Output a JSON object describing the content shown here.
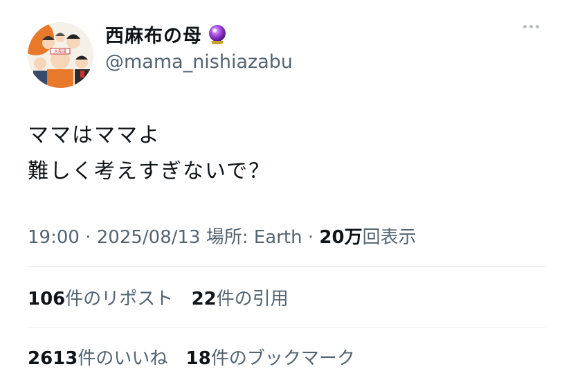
{
  "user": {
    "display_name": "西麻布の母",
    "badge_icon": "crystal-ball-icon",
    "handle": "@mama_nishiazabu",
    "avatar_sign_text": "大和魂"
  },
  "tweet": {
    "lines": [
      "ママはママよ",
      "難しく考えすぎないで？"
    ]
  },
  "meta": {
    "time": "19:00",
    "date": "2025/08/13",
    "location_label": "場所: Earth",
    "views_count": "20万",
    "views_label": "回表示"
  },
  "stats": {
    "reposts_count": "106",
    "reposts_label": "件のリポスト",
    "quotes_count": "22",
    "quotes_label": "件の引用",
    "likes_count": "2613",
    "likes_label": "件のいいね",
    "bookmarks_count": "18",
    "bookmarks_label": "件のブックマーク"
  },
  "colors": {
    "text": "#0f1419",
    "secondary": "#536471",
    "divider": "#dfe3e6",
    "avatar_orange": "#e8792b"
  }
}
